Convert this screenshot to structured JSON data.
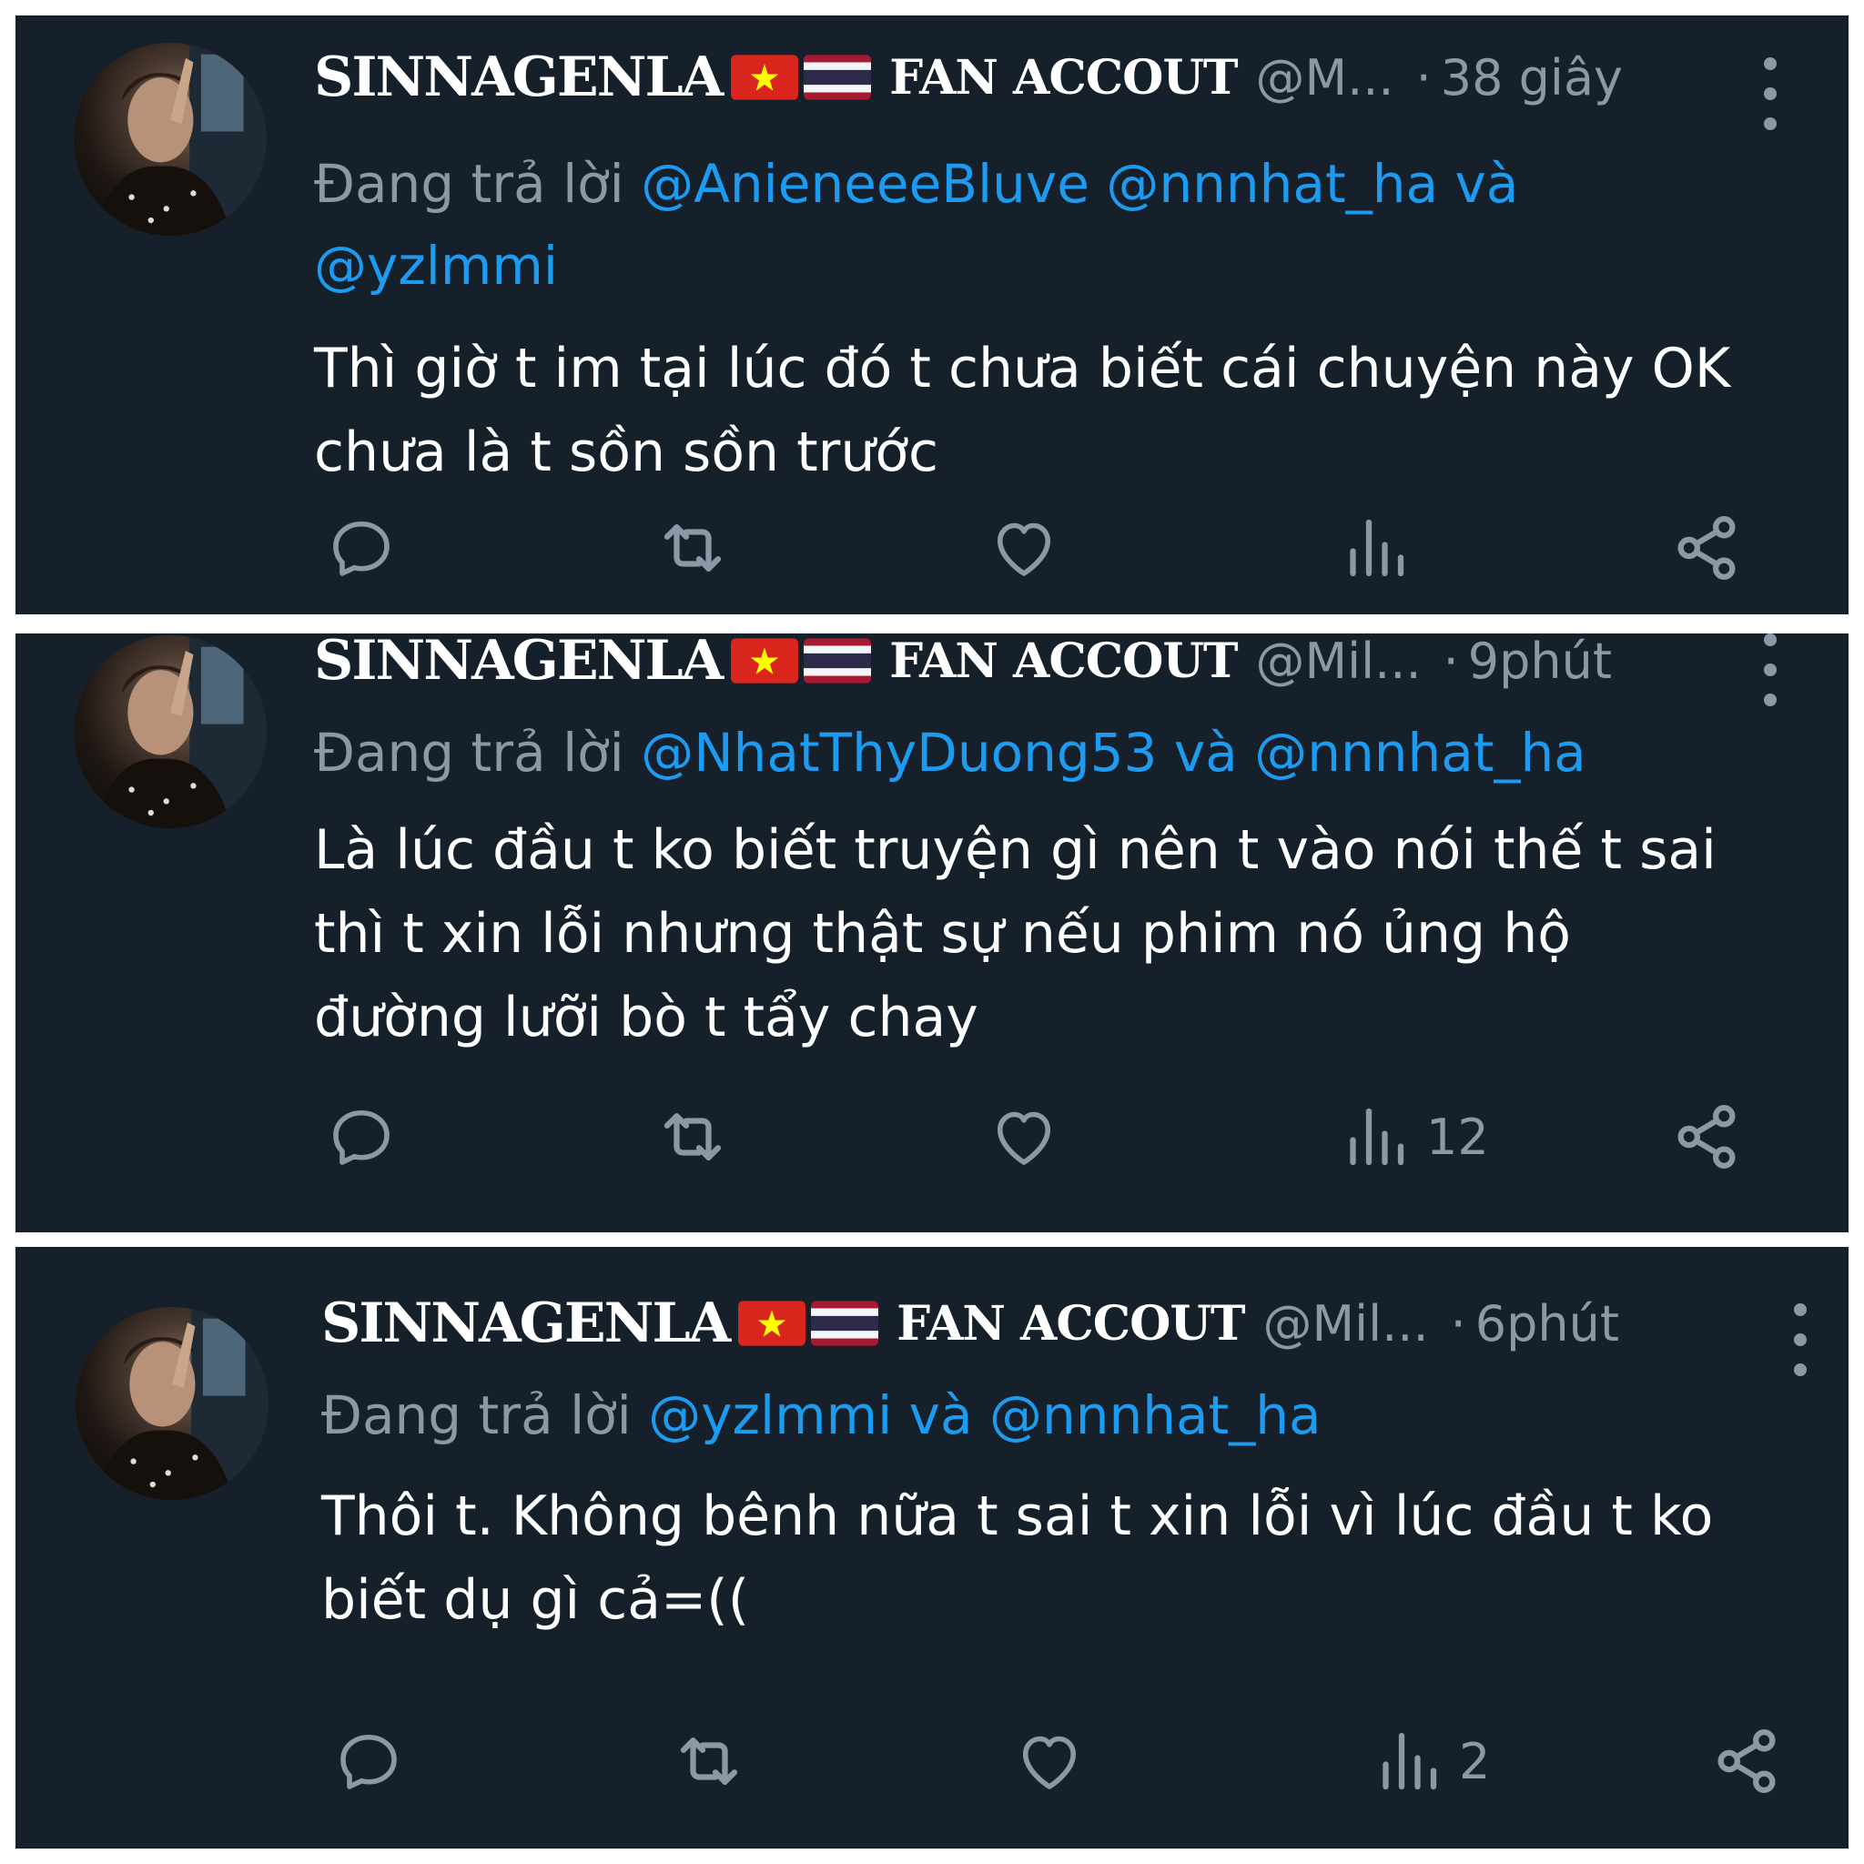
{
  "colors": {
    "background": "#15202b",
    "text": "#ffffff",
    "muted": "#8b98a5",
    "link": "#1d9bf0"
  },
  "tweets": [
    {
      "display_name": "SINNAGENLA",
      "flags": [
        "vietnam-flag",
        "thailand-flag"
      ],
      "account_suffix": "FAN ACCOUT",
      "handle": "@M...",
      "separator": "·",
      "time": "38 giây",
      "reply_prefix": "Đang trả lời",
      "mentions": [
        "@AnieneeeBluve",
        "@nnnhat_ha",
        "@yzlmmi"
      ],
      "conjunction": "và",
      "body_lines": [
        "Thì giờ t im tại lúc đó t chưa biết cái chuyện này OK",
        "chưa là t sồn sồn trước"
      ],
      "views": ""
    },
    {
      "display_name": "SINNAGENLA",
      "flags": [
        "vietnam-flag",
        "thailand-flag"
      ],
      "account_suffix": "FAN ACCOUT",
      "handle": "@Mil...",
      "separator": "·",
      "time": "9phút",
      "reply_prefix": "Đang trả lời",
      "mentions": [
        "@NhatThyDuong53",
        "@nnnhat_ha"
      ],
      "conjunction": "và",
      "body_lines": [
        "Là lúc đầu t ko biết truyện gì nên t vào nói thế t sai",
        "thì t xin lỗi nhưng thật sự nếu phim nó ủng hộ",
        "đường lưỡi bò t tẩy chay"
      ],
      "views": "12"
    },
    {
      "display_name": "SINNAGENLA",
      "flags": [
        "vietnam-flag",
        "thailand-flag"
      ],
      "account_suffix": "FAN ACCOUT",
      "handle": "@Mil...",
      "separator": "·",
      "time": "6phút",
      "reply_prefix": "Đang trả lời",
      "mentions": [
        "@yzlmmi",
        "@nnnhat_ha"
      ],
      "conjunction": "và",
      "body_lines": [
        "Thôi t. Không bênh nữa t sai t xin lỗi vì lúc đầu t ko",
        "biết dụ gì cả=(("
      ],
      "views": "2"
    }
  ],
  "icons": {
    "reply": "reply-bubble-icon",
    "retweet": "retweet-icon",
    "like": "heart-icon",
    "views": "analytics-bars-icon",
    "share": "share-icon",
    "more": "more-vertical-icon"
  }
}
